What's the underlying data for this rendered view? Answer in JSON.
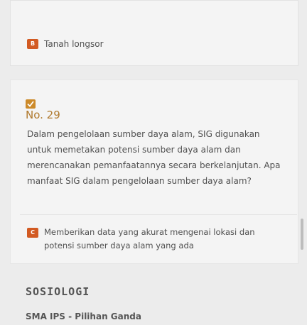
{
  "previous_answer": {
    "badge": "B",
    "text": "Tanah longsor"
  },
  "question": {
    "number": "No. 29",
    "text": "Dalam pengelolaan sumber daya alam, SIG digunakan untuk memetakan potensi sumber daya alam dan merencanakan pemanfaatannya secara berkelanjutan. Apa manfaat SIG dalam pengelolaan sumber daya alam?",
    "answer_badge": "C",
    "answer_text": "Memberikan data yang akurat mengenai lokasi dan potensi sumber daya alam yang ada"
  },
  "footer": {
    "subject": "SOSIOLOGI",
    "sub_label": "SMA IPS - Pilihan Ganda"
  },
  "icons": {
    "check": "checkbox-check-icon"
  },
  "colors": {
    "badge": "#d25a22",
    "number": "#b07a2f",
    "check": "#cc8a2a"
  }
}
